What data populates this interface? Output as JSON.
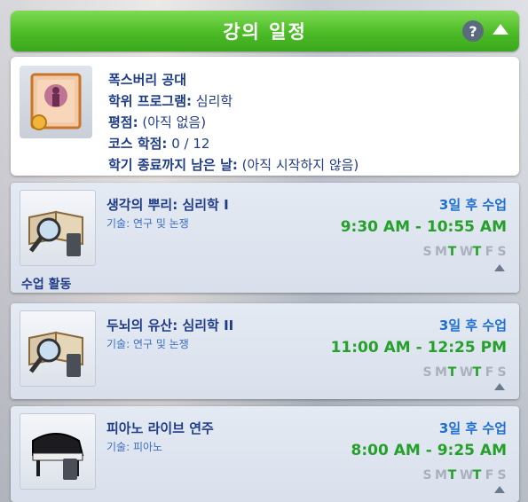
{
  "header": {
    "title": "강의 일정",
    "help_label": "?"
  },
  "degree": {
    "university": "폭스버리 공대",
    "program_label": "학위 프로그램:",
    "program_value": " 심리학",
    "gpa_label": "평점:",
    "gpa_value": " (아직 없음)",
    "credits_label": "코스 학점:",
    "credits_value": " 0 / 12",
    "term_end_label": "학기 종료까지 남은 날:",
    "term_end_value": " (아직 시작하지 않음)"
  },
  "courses": [
    {
      "name": "생각의 뿌리: 심리학 I",
      "skill": "기술: 연구 및 논쟁",
      "when": "3일 후 수업",
      "time": "9:30  AM - 10:55  AM",
      "activity_label": "수업 활동",
      "days": [
        {
          "letter": "S",
          "on": false
        },
        {
          "letter": "M",
          "on": false
        },
        {
          "letter": "T",
          "on": true
        },
        {
          "letter": "W",
          "on": false
        },
        {
          "letter": "T",
          "on": true
        },
        {
          "letter": "F",
          "on": false
        },
        {
          "letter": "S",
          "on": false
        }
      ]
    },
    {
      "name": "두뇌의 유산: 심리학 II",
      "skill": "기술: 연구 및 논쟁",
      "when": "3일 후 수업",
      "time": "11:00  AM - 12:25  PM",
      "days": [
        {
          "letter": "S",
          "on": false
        },
        {
          "letter": "M",
          "on": false
        },
        {
          "letter": "T",
          "on": true
        },
        {
          "letter": "W",
          "on": false
        },
        {
          "letter": "T",
          "on": true
        },
        {
          "letter": "F",
          "on": false
        },
        {
          "letter": "S",
          "on": false
        }
      ]
    },
    {
      "name": "피아노 라이브 연주",
      "skill": "기술: 피아노",
      "when": "3일 후 수업",
      "time": "8:00  AM - 9:25  AM",
      "days": [
        {
          "letter": "S",
          "on": false
        },
        {
          "letter": "M",
          "on": false
        },
        {
          "letter": "T",
          "on": true
        },
        {
          "letter": "W",
          "on": false
        },
        {
          "letter": "T",
          "on": true
        },
        {
          "letter": "F",
          "on": false
        },
        {
          "letter": "S",
          "on": false
        }
      ]
    }
  ],
  "colors": {
    "accent_green": "#4cbb27",
    "text_blue": "#1f3c86",
    "active_day": "#25a02a"
  }
}
